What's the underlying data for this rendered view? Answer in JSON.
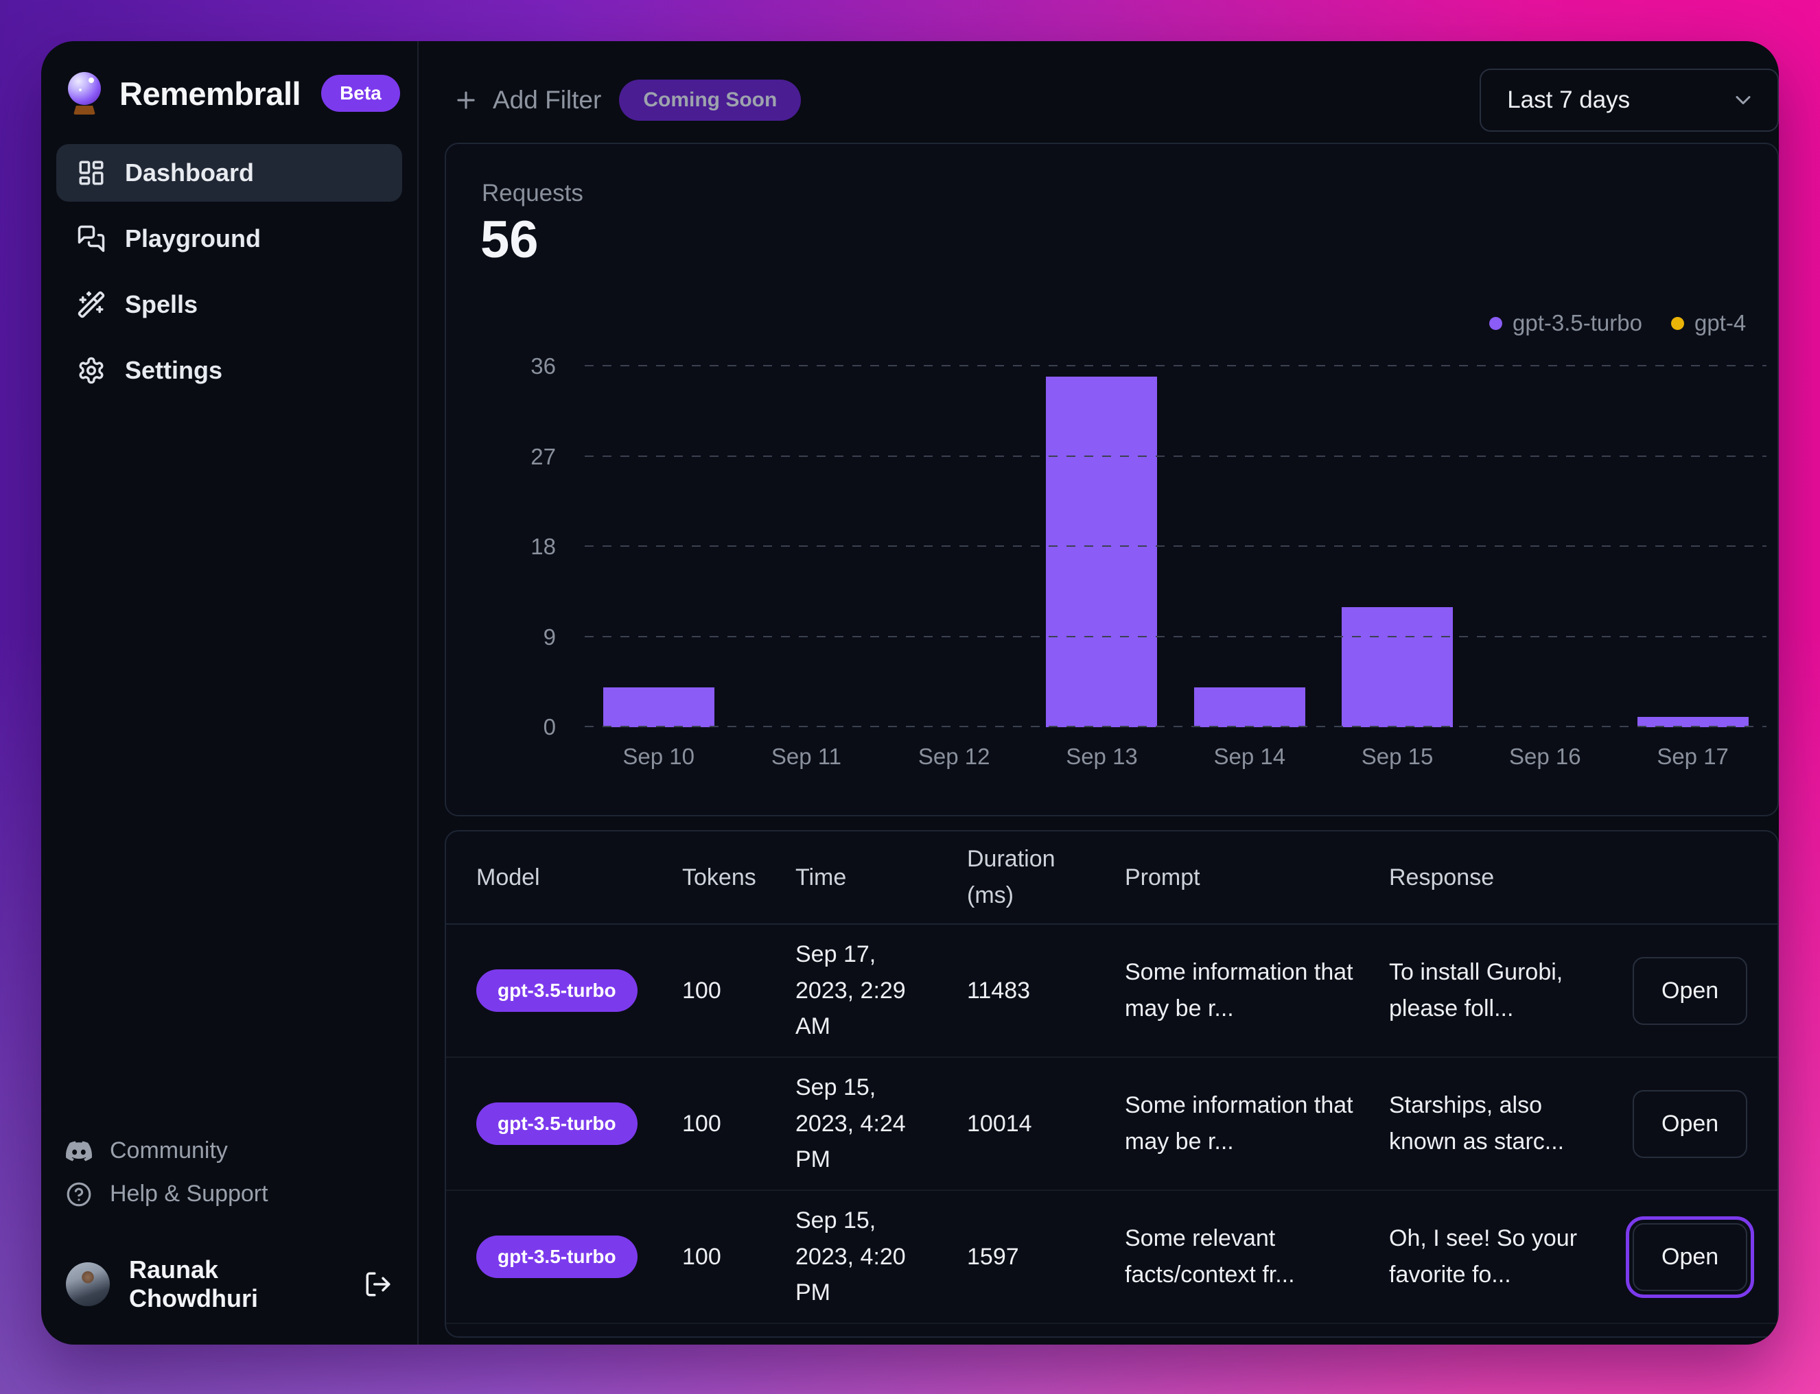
{
  "app": {
    "name": "Remembrall",
    "beta_badge": "Beta",
    "logo_icon": "crystal-ball-icon"
  },
  "sidebar": {
    "items": [
      {
        "label": "Dashboard",
        "icon": "layout-dashboard-icon",
        "active": true
      },
      {
        "label": "Playground",
        "icon": "chat-bubbles-icon",
        "active": false
      },
      {
        "label": "Spells",
        "icon": "magic-wand-icon",
        "active": false
      },
      {
        "label": "Settings",
        "icon": "gear-icon",
        "active": false
      }
    ],
    "footer_items": [
      {
        "label": "Community",
        "icon": "discord-icon"
      },
      {
        "label": "Help & Support",
        "icon": "help-circle-icon"
      }
    ],
    "user": {
      "name": "Raunak Chowdhuri",
      "logout_icon": "logout-icon"
    }
  },
  "toolbar": {
    "add_filter_label": "Add Filter",
    "coming_soon_label": "Coming Soon",
    "date_range": "Last 7 days"
  },
  "stats": {
    "requests_label": "Requests",
    "requests_value": "56"
  },
  "chart_data": {
    "type": "bar",
    "title": "Requests",
    "total_requests": 56,
    "categories": [
      "Sep 10",
      "Sep 11",
      "Sep 12",
      "Sep 13",
      "Sep 14",
      "Sep 15",
      "Sep 16",
      "Sep 17"
    ],
    "series": [
      {
        "name": "gpt-3.5-turbo",
        "color": "#8b5cf6",
        "values": [
          4,
          0,
          0,
          35,
          4,
          12,
          0,
          1
        ]
      },
      {
        "name": "gpt-4",
        "color": "#eab308",
        "values": [
          0,
          0,
          0,
          0,
          0,
          0,
          0,
          0
        ]
      }
    ],
    "xlabel": "",
    "ylabel": "",
    "ylim": [
      0,
      36
    ],
    "yticks": [
      0,
      9,
      18,
      27,
      36
    ],
    "grid": "horizontal-dashed",
    "legend_position": "top-right"
  },
  "table": {
    "columns": [
      "Model",
      "Tokens",
      "Time",
      "Duration (ms)",
      "Prompt",
      "Response"
    ],
    "action_label": "Open",
    "rows": [
      {
        "model": "gpt-3.5-turbo",
        "tokens": "100",
        "time": "Sep 17, 2023, 2:29 AM",
        "duration": "11483",
        "prompt": "Some information that may be r...",
        "response": "To install Gurobi, please foll...",
        "action": "Open",
        "focused": false
      },
      {
        "model": "gpt-3.5-turbo",
        "tokens": "100",
        "time": "Sep 15, 2023, 4:24 PM",
        "duration": "10014",
        "prompt": "Some information that may be r...",
        "response": "Starships, also known as starc...",
        "action": "Open",
        "focused": false
      },
      {
        "model": "gpt-3.5-turbo",
        "tokens": "100",
        "time": "Sep 15, 2023, 4:20 PM",
        "duration": "1597",
        "prompt": "Some relevant facts/context fr...",
        "response": "Oh, I see! So your favorite fo...",
        "action": "Open",
        "focused": true
      }
    ]
  },
  "colors": {
    "accent_purple": "#7c3aed",
    "bar_purple": "#8b5cf6",
    "gpt4_yellow": "#eab308",
    "desktop_gradient_left": "#54189f",
    "desktop_gradient_right": "#ee0d9a",
    "window_background": "#090c13"
  }
}
